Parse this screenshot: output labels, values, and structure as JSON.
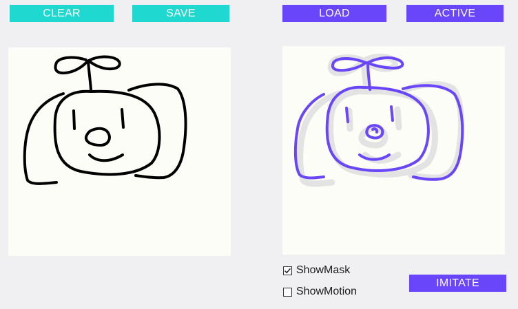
{
  "toolbar": {
    "clear_label": "CLEAR",
    "save_label": "SAVE",
    "load_label": "LOAD",
    "active_label": "ACTIVE"
  },
  "options": {
    "show_mask_label": "ShowMask",
    "show_mask_checked": true,
    "show_motion_label": "ShowMotion",
    "show_motion_checked": false
  },
  "actions": {
    "imitate_label": "IMITATE"
  },
  "colors": {
    "teal": "#1fd8cf",
    "purple": "#6a46fb",
    "canvas_bg": "#fdfdf7",
    "stroke_user": "#000000",
    "stroke_output": "#6a46fb",
    "mask": "#e3e3e3"
  }
}
